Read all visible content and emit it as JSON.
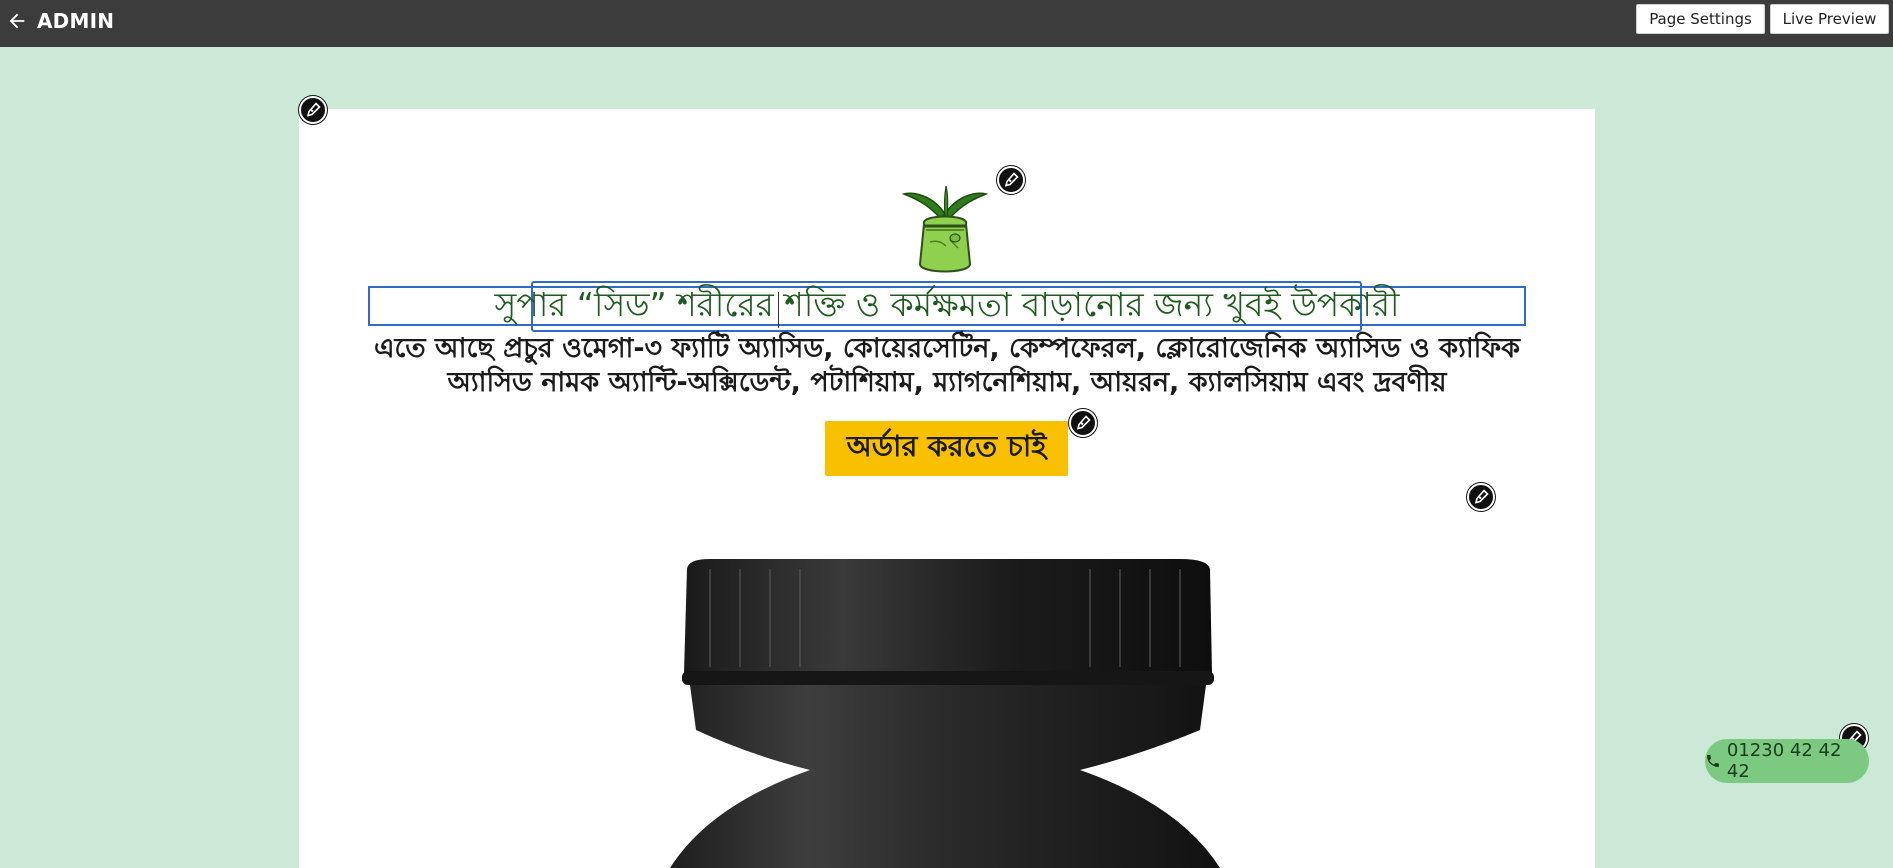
{
  "topbar": {
    "brand": "ADMIN",
    "page_settings_label": "Page Settings",
    "live_preview_label": "Live Preview"
  },
  "hero": {
    "headline": "সুপার “সিড” শরীরের শক্তি ও কর্মক্ষমতা বাড়ানোর জন্য খুবই উপকারী",
    "subtext": "এতে আছে প্রচুর ওমেগা-৩ ফ্যাটি অ্যাসিড, কোয়েরসেটিন, কেম্পফেরল, ক্লোরোজেনিক অ্যাসিড ও ক্যাফিক অ্যাসিড নামক অ্যান্টি-অক্সিডেন্ট, পটাশিয়াম, ম্যাগনেশিয়াম, আয়রন, ক্যালসিয়াম এবং দ্রবণীয়",
    "order_button_label": "অর্ডার করতে চাই"
  },
  "call_button": {
    "phone": "01230 42 42 42"
  },
  "colors": {
    "background": "#cce9d8",
    "topbar": "#3c3c3c",
    "headline": "#1f5a1f",
    "order_button": "#f8c000",
    "call_button": "#7cca82",
    "selection_outline": "#2f6bc7"
  },
  "icons": [
    "back-arrow-icon",
    "pen-edit-icon",
    "phone-icon",
    "seed-pouch-logo",
    "product-jar-image"
  ]
}
